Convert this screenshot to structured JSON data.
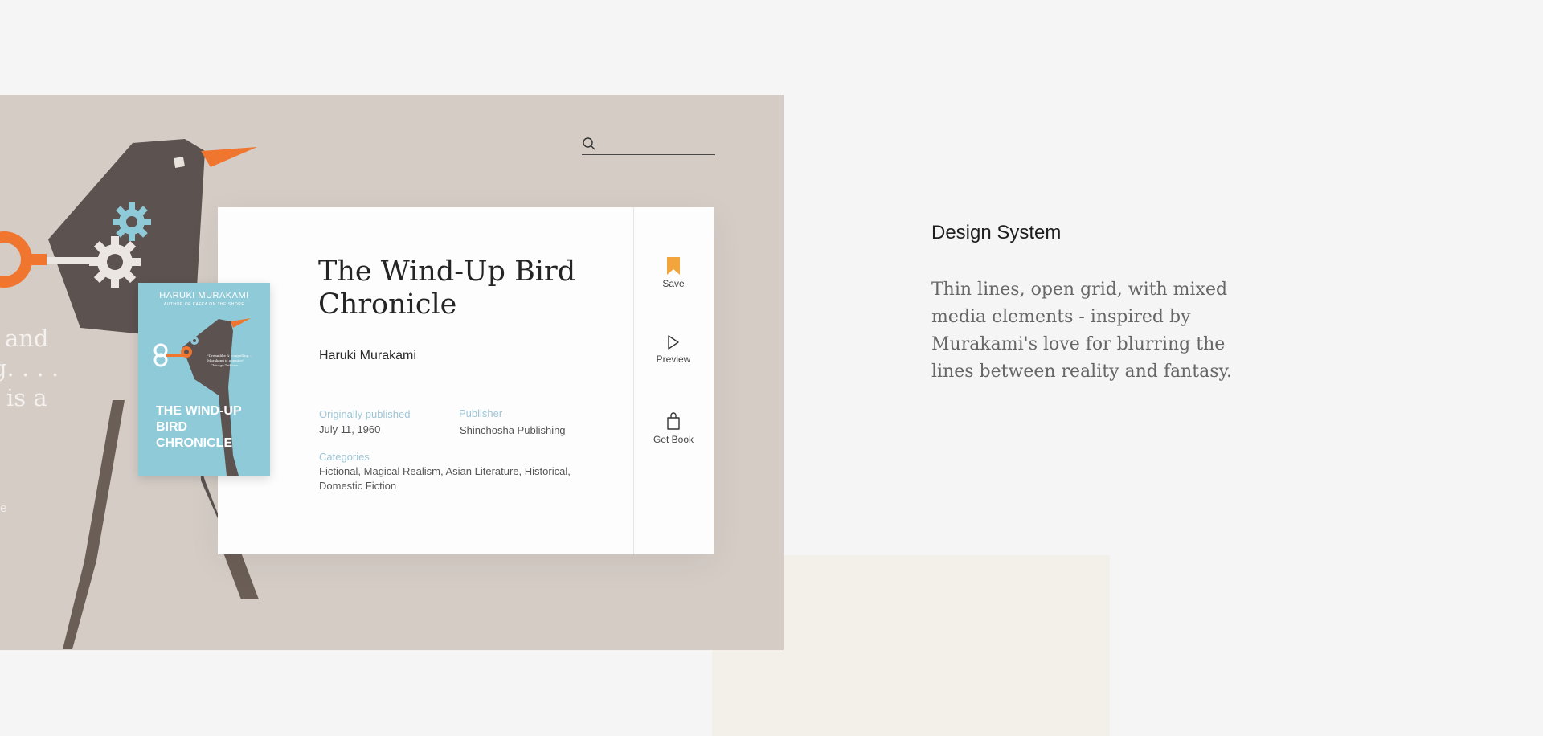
{
  "hero": {
    "quote_lines": [
      "ke and",
      "ing. . . .",
      "mi is a"
    ],
    "link_fragment": "e",
    "search": {
      "placeholder": "",
      "value": "",
      "icon": "search-icon"
    }
  },
  "book": {
    "title": "The Wind-Up Bird Chronicle",
    "author": "Haruki Murakami",
    "published_label": "Originally published",
    "published_value": "July 11, 1960",
    "publisher_label": "Publisher",
    "publisher_value": "Shinchosha Publishing",
    "categories_label": "Categories",
    "categories_value": "Fictional, Magical Realism, Asian Literature, Historical, Domestic Fiction",
    "cover": {
      "author": "HARUKI MURAKAMI",
      "subtitle": "AUTHOR OF KAFKA ON THE SHORE",
      "title": "THE WIND-UP BIRD CHRONICLE",
      "quote": "\"Dreamlike & compelling... Murakami is a genius\"",
      "quote_source": "—Chicago Tribune"
    }
  },
  "actions": [
    {
      "label": "Save",
      "icon": "bookmark-icon",
      "color": "#f2a53a"
    },
    {
      "label": "Preview",
      "icon": "play-icon"
    },
    {
      "label": "Get Book",
      "icon": "shopping-bag-icon"
    }
  ],
  "design_system": {
    "title": "Design System",
    "body": "Thin lines, open grid, with mixed media elements - inspired by Murakami's love for blurring the lines between reality and fantasy."
  },
  "colors": {
    "hero_bg": "#d5ccc6",
    "accent_orange": "#f0752f",
    "accent_teal": "#8fcad8",
    "bird_dark": "#5c5350",
    "label_blue": "#9ec5d4"
  }
}
